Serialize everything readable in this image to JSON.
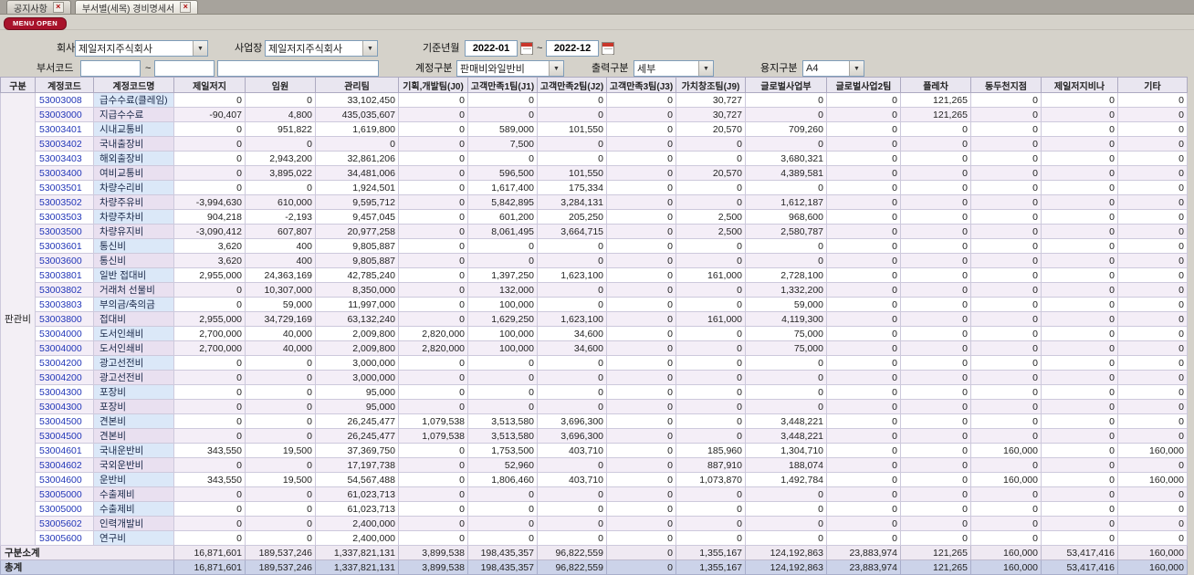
{
  "tabs": [
    {
      "label": "공지사항"
    },
    {
      "label": "부서별(세목) 경비명세서"
    }
  ],
  "menu_open_label": "MENU OPEN",
  "icons": {
    "tab_close": "×",
    "combo_arrow": "▼"
  },
  "filters": {
    "company_label": "회사",
    "company_value": "제일저지주식회사",
    "site_label": "사업장",
    "site_value": "제일저지주식회사",
    "period_label": "기준년월",
    "period_from": "2022-01",
    "period_to": "2022-12",
    "tilde": "~",
    "dept_label": "부서코드",
    "dept_from": "",
    "dept_to": "",
    "dept_name": "",
    "account_label": "계정구분",
    "account_value": "판매비와일반비",
    "output_label": "출력구분",
    "output_value": "세부",
    "paper_label": "용지구분",
    "paper_value": "A4"
  },
  "table": {
    "headers": [
      "구분",
      "계정코드",
      "계정코드명",
      "제일저지",
      "임원",
      "관리팀",
      "기획,개발팀(J0)",
      "고객만족1팀(J1)",
      "고객만족2팀(J2)",
      "고객만족3팀(J3)",
      "가치창조팀(J9)",
      "글로벌사업부",
      "글로벌사업2팀",
      "플레차",
      "동두천지점",
      "제일저지비나",
      "기타"
    ],
    "group_label": "판관비",
    "rows": [
      {
        "code": "53003008",
        "name": "급수수료(클레임)",
        "values": [
          "0",
          "0",
          "33,102,450",
          "0",
          "0",
          "0",
          "0",
          "30,727",
          "0",
          "0",
          "121,265",
          "0",
          "0",
          "0"
        ]
      },
      {
        "code": "53003000",
        "name": "지급수수료",
        "values": [
          "-90,407",
          "4,800",
          "435,035,607",
          "0",
          "0",
          "0",
          "0",
          "30,727",
          "0",
          "0",
          "121,265",
          "0",
          "0",
          "0"
        ]
      },
      {
        "code": "53003401",
        "name": "시내교통비",
        "values": [
          "0",
          "951,822",
          "1,619,800",
          "0",
          "589,000",
          "101,550",
          "0",
          "20,570",
          "709,260",
          "0",
          "0",
          "0",
          "0",
          "0"
        ]
      },
      {
        "code": "53003402",
        "name": "국내출장비",
        "values": [
          "0",
          "0",
          "0",
          "0",
          "7,500",
          "0",
          "0",
          "0",
          "0",
          "0",
          "0",
          "0",
          "0",
          "0"
        ]
      },
      {
        "code": "53003403",
        "name": "해외출장비",
        "values": [
          "0",
          "2,943,200",
          "32,861,206",
          "0",
          "0",
          "0",
          "0",
          "0",
          "3,680,321",
          "0",
          "0",
          "0",
          "0",
          "0"
        ]
      },
      {
        "code": "53003400",
        "name": "여비교통비",
        "values": [
          "0",
          "3,895,022",
          "34,481,006",
          "0",
          "596,500",
          "101,550",
          "0",
          "20,570",
          "4,389,581",
          "0",
          "0",
          "0",
          "0",
          "0"
        ]
      },
      {
        "code": "53003501",
        "name": "차량수리비",
        "values": [
          "0",
          "0",
          "1,924,501",
          "0",
          "1,617,400",
          "175,334",
          "0",
          "0",
          "0",
          "0",
          "0",
          "0",
          "0",
          "0"
        ]
      },
      {
        "code": "53003502",
        "name": "차량주유비",
        "values": [
          "-3,994,630",
          "610,000",
          "9,595,712",
          "0",
          "5,842,895",
          "3,284,131",
          "0",
          "0",
          "1,612,187",
          "0",
          "0",
          "0",
          "0",
          "0"
        ]
      },
      {
        "code": "53003503",
        "name": "차량주차비",
        "values": [
          "904,218",
          "-2,193",
          "9,457,045",
          "0",
          "601,200",
          "205,250",
          "0",
          "2,500",
          "968,600",
          "0",
          "0",
          "0",
          "0",
          "0"
        ]
      },
      {
        "code": "53003500",
        "name": "차량유지비",
        "values": [
          "-3,090,412",
          "607,807",
          "20,977,258",
          "0",
          "8,061,495",
          "3,664,715",
          "0",
          "2,500",
          "2,580,787",
          "0",
          "0",
          "0",
          "0",
          "0"
        ]
      },
      {
        "code": "53003601",
        "name": "통신비",
        "values": [
          "3,620",
          "400",
          "9,805,887",
          "0",
          "0",
          "0",
          "0",
          "0",
          "0",
          "0",
          "0",
          "0",
          "0",
          "0"
        ]
      },
      {
        "code": "53003600",
        "name": "통신비",
        "values": [
          "3,620",
          "400",
          "9,805,887",
          "0",
          "0",
          "0",
          "0",
          "0",
          "0",
          "0",
          "0",
          "0",
          "0",
          "0"
        ]
      },
      {
        "code": "53003801",
        "name": "일반 접대비",
        "values": [
          "2,955,000",
          "24,363,169",
          "42,785,240",
          "0",
          "1,397,250",
          "1,623,100",
          "0",
          "161,000",
          "2,728,100",
          "0",
          "0",
          "0",
          "0",
          "0"
        ]
      },
      {
        "code": "53003802",
        "name": "거래처 선물비",
        "values": [
          "0",
          "10,307,000",
          "8,350,000",
          "0",
          "132,000",
          "0",
          "0",
          "0",
          "1,332,200",
          "0",
          "0",
          "0",
          "0",
          "0"
        ]
      },
      {
        "code": "53003803",
        "name": "부의금/축의금",
        "values": [
          "0",
          "59,000",
          "11,997,000",
          "0",
          "100,000",
          "0",
          "0",
          "0",
          "59,000",
          "0",
          "0",
          "0",
          "0",
          "0"
        ]
      },
      {
        "code": "53003800",
        "name": "접대비",
        "values": [
          "2,955,000",
          "34,729,169",
          "63,132,240",
          "0",
          "1,629,250",
          "1,623,100",
          "0",
          "161,000",
          "4,119,300",
          "0",
          "0",
          "0",
          "0",
          "0"
        ]
      },
      {
        "code": "53004000",
        "name": "도서인쇄비",
        "values": [
          "2,700,000",
          "40,000",
          "2,009,800",
          "2,820,000",
          "100,000",
          "34,600",
          "0",
          "0",
          "75,000",
          "0",
          "0",
          "0",
          "0",
          "0"
        ]
      },
      {
        "code": "53004000",
        "name": "도서인쇄비",
        "values": [
          "2,700,000",
          "40,000",
          "2,009,800",
          "2,820,000",
          "100,000",
          "34,600",
          "0",
          "0",
          "75,000",
          "0",
          "0",
          "0",
          "0",
          "0"
        ]
      },
      {
        "code": "53004200",
        "name": "광고선전비",
        "values": [
          "0",
          "0",
          "3,000,000",
          "0",
          "0",
          "0",
          "0",
          "0",
          "0",
          "0",
          "0",
          "0",
          "0",
          "0"
        ]
      },
      {
        "code": "53004200",
        "name": "광고선전비",
        "values": [
          "0",
          "0",
          "3,000,000",
          "0",
          "0",
          "0",
          "0",
          "0",
          "0",
          "0",
          "0",
          "0",
          "0",
          "0"
        ]
      },
      {
        "code": "53004300",
        "name": "포장비",
        "values": [
          "0",
          "0",
          "95,000",
          "0",
          "0",
          "0",
          "0",
          "0",
          "0",
          "0",
          "0",
          "0",
          "0",
          "0"
        ]
      },
      {
        "code": "53004300",
        "name": "포장비",
        "values": [
          "0",
          "0",
          "95,000",
          "0",
          "0",
          "0",
          "0",
          "0",
          "0",
          "0",
          "0",
          "0",
          "0",
          "0"
        ]
      },
      {
        "code": "53004500",
        "name": "견본비",
        "values": [
          "0",
          "0",
          "26,245,477",
          "1,079,538",
          "3,513,580",
          "3,696,300",
          "0",
          "0",
          "3,448,221",
          "0",
          "0",
          "0",
          "0",
          "0"
        ]
      },
      {
        "code": "53004500",
        "name": "견본비",
        "values": [
          "0",
          "0",
          "26,245,477",
          "1,079,538",
          "3,513,580",
          "3,696,300",
          "0",
          "0",
          "3,448,221",
          "0",
          "0",
          "0",
          "0",
          "0"
        ]
      },
      {
        "code": "53004601",
        "name": "국내운반비",
        "values": [
          "343,550",
          "19,500",
          "37,369,750",
          "0",
          "1,753,500",
          "403,710",
          "0",
          "185,960",
          "1,304,710",
          "0",
          "0",
          "160,000",
          "0",
          "160,000"
        ]
      },
      {
        "code": "53004602",
        "name": "국외운반비",
        "values": [
          "0",
          "0",
          "17,197,738",
          "0",
          "52,960",
          "0",
          "0",
          "887,910",
          "188,074",
          "0",
          "0",
          "0",
          "0",
          "0"
        ]
      },
      {
        "code": "53004600",
        "name": "운반비",
        "values": [
          "343,550",
          "19,500",
          "54,567,488",
          "0",
          "1,806,460",
          "403,710",
          "0",
          "1,073,870",
          "1,492,784",
          "0",
          "0",
          "160,000",
          "0",
          "160,000"
        ]
      },
      {
        "code": "53005000",
        "name": "수출제비",
        "values": [
          "0",
          "0",
          "61,023,713",
          "0",
          "0",
          "0",
          "0",
          "0",
          "0",
          "0",
          "0",
          "0",
          "0",
          "0"
        ]
      },
      {
        "code": "53005000",
        "name": "수출제비",
        "values": [
          "0",
          "0",
          "61,023,713",
          "0",
          "0",
          "0",
          "0",
          "0",
          "0",
          "0",
          "0",
          "0",
          "0",
          "0"
        ]
      },
      {
        "code": "53005602",
        "name": "인력개발비",
        "values": [
          "0",
          "0",
          "2,400,000",
          "0",
          "0",
          "0",
          "0",
          "0",
          "0",
          "0",
          "0",
          "0",
          "0",
          "0"
        ]
      },
      {
        "code": "53005600",
        "name": "연구비",
        "values": [
          "0",
          "0",
          "2,400,000",
          "0",
          "0",
          "0",
          "0",
          "0",
          "0",
          "0",
          "0",
          "0",
          "0",
          "0"
        ]
      }
    ],
    "subtotal": {
      "label": "구분소계",
      "values": [
        "16,871,601",
        "189,537,246",
        "1,337,821,131",
        "3,899,538",
        "198,435,357",
        "96,822,559",
        "0",
        "1,355,167",
        "124,192,863",
        "23,883,974",
        "121,265",
        "160,000",
        "53,417,416",
        "160,000"
      ]
    },
    "total": {
      "label": "총계",
      "values": [
        "16,871,601",
        "189,537,246",
        "1,337,821,131",
        "3,899,538",
        "198,435,357",
        "96,822,559",
        "0",
        "1,355,167",
        "124,192,863",
        "23,883,974",
        "121,265",
        "160,000",
        "53,417,416",
        "160,000"
      ]
    }
  }
}
